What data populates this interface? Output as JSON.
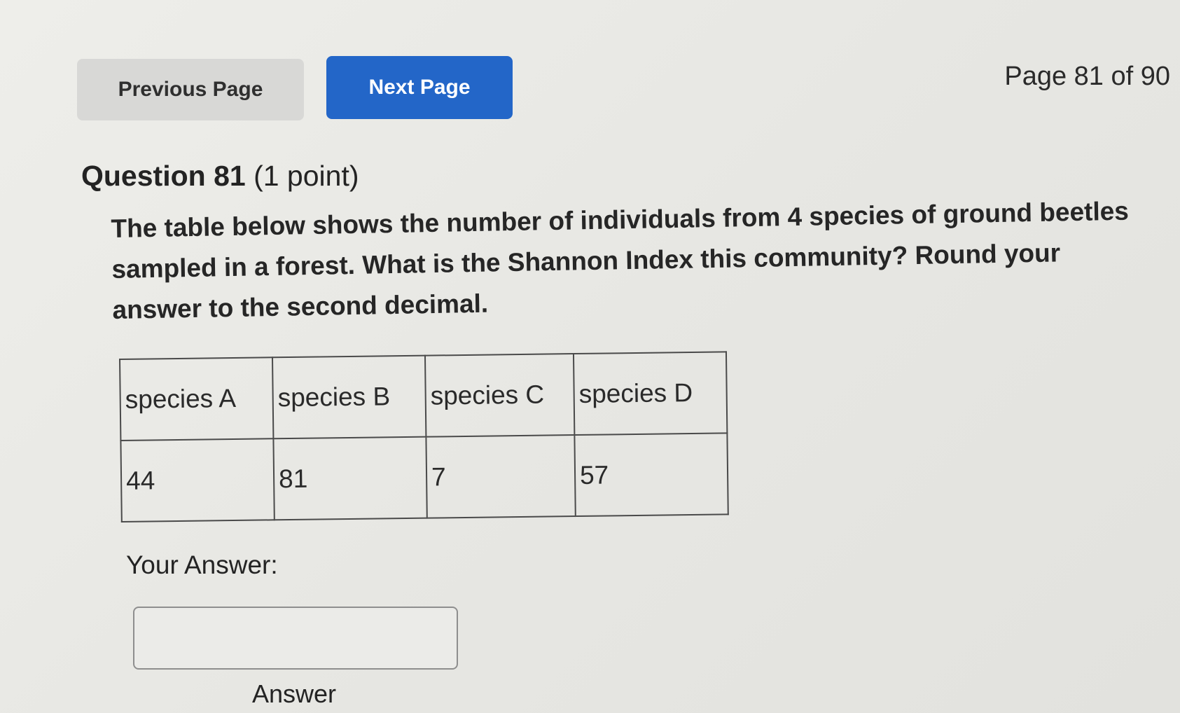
{
  "nav": {
    "previous_label": "Previous Page",
    "next_label": "Next Page",
    "page_indicator": "Page 81 of 90"
  },
  "question": {
    "number_label": "Question 81",
    "points_label": "(1 point)",
    "text": "The table below shows the number of individuals from 4 species of ground beetles sampled in a forest. What is the Shannon Index this community? Round  your answer to the second decimal."
  },
  "table": {
    "headers": [
      "species A",
      "species B",
      "species C",
      "species D"
    ],
    "values": [
      "44",
      "81",
      "7",
      "57"
    ]
  },
  "answer": {
    "label": "Your Answer:",
    "value": "",
    "caption": "Answer"
  }
}
